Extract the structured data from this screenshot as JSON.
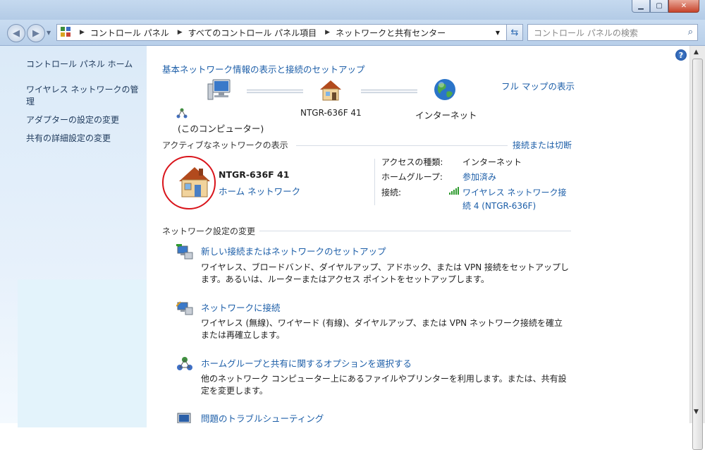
{
  "breadcrumb": [
    "コントロール パネル",
    "すべてのコントロール パネル項目",
    "ネットワークと共有センター"
  ],
  "search": {
    "placeholder": "コントロール パネルの検索"
  },
  "sidebar": {
    "items": [
      {
        "label": "コントロール パネル ホーム"
      },
      {
        "label": "ワイヤレス ネットワークの管理"
      },
      {
        "label": "アダプターの設定の変更"
      },
      {
        "label": "共有の詳細設定の変更"
      }
    ]
  },
  "main": {
    "heading": "基本ネットワーク情報の表示と接続のセットアップ",
    "full_map": "フル マップの表示",
    "map": {
      "computer_label": "(このコンピューター)",
      "router_label": "NTGR-636F  41",
      "internet_label": "インターネット"
    },
    "active_section": {
      "title": "アクティブなネットワークの表示",
      "connect_link": "接続または切断",
      "network_name": "NTGR-636F  41",
      "network_type": "ホーム ネットワーク",
      "access_type_label": "アクセスの種類:",
      "access_type_value": "インターネット",
      "homegroup_label": "ホームグループ:",
      "homegroup_value": "参加済み",
      "connection_label": "接続:",
      "connection_value_line1": "ワイヤレス ネットワーク接",
      "connection_value_line2": "続 4 (NTGR-636F)"
    },
    "change_section": {
      "title": "ネットワーク設定の変更",
      "tasks": [
        {
          "title": "新しい接続またはネットワークのセットアップ",
          "desc1": "ワイヤレス、ブロードバンド、ダイヤルアップ、アドホック、または VPN 接続をセットアップし",
          "desc2": "ます。あるいは、ルーターまたはアクセス ポイントをセットアップします。"
        },
        {
          "title": "ネットワークに接続",
          "desc1": "ワイヤレス (無線)、ワイヤード (有線)、ダイヤルアップ、または VPN ネットワーク接続を確立",
          "desc2": "または再確立します。"
        },
        {
          "title": "ホームグループと共有に関するオプションを選択する",
          "desc1": "他のネットワーク コンピューター上にあるファイルやプリンターを利用します。または、共有設",
          "desc2": "定を変更します。"
        },
        {
          "title": "問題のトラブルシューティング"
        }
      ]
    }
  },
  "colors": {
    "link": "#1c5ea8",
    "highlight_circle": "#d9141b",
    "sidebar_bg": "#dbeaf8"
  }
}
